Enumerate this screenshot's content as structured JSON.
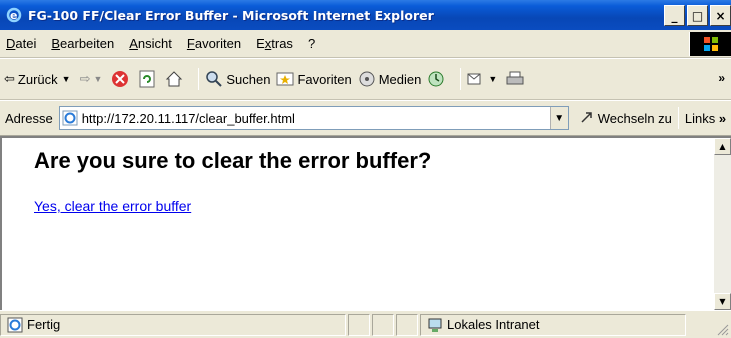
{
  "window": {
    "title": "FG-100 FF/Clear Error Buffer - Microsoft Internet Explorer",
    "minimize": "_",
    "maximize": "□",
    "close": "×"
  },
  "menu": {
    "items": [
      {
        "label": "Datei",
        "accel": "D"
      },
      {
        "label": "Bearbeiten",
        "accel": "B"
      },
      {
        "label": "Ansicht",
        "accel": "A"
      },
      {
        "label": "Favoriten",
        "accel": "F"
      },
      {
        "label": "Extras",
        "accel": "x"
      },
      {
        "label": "?",
        "accel": "?"
      }
    ]
  },
  "toolbar": {
    "back_label": "Zurück",
    "search_label": "Suchen",
    "favorites_label": "Favoriten",
    "media_label": "Medien",
    "more": "»"
  },
  "address": {
    "label": "Adresse",
    "url": "http://172.20.11.117/clear_buffer.html",
    "go_label": "Wechseln zu",
    "links_label": "Links",
    "links_more": "»"
  },
  "page": {
    "heading": "Are you sure to clear the error buffer?",
    "link_text": "Yes, clear the error buffer"
  },
  "status": {
    "text": "Fertig",
    "zone": "Lokales Intranet"
  },
  "colors": {
    "titlebar": "#0a4cc0",
    "link": "#0000ee",
    "chrome": "#ece9d8"
  }
}
